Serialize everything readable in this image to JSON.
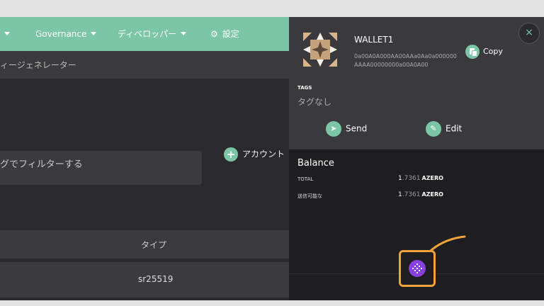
{
  "nav": {
    "governance": "Governance",
    "developer": "ディベロッパー",
    "settings": "設定"
  },
  "subbar": {
    "text": "ィージェネレーター"
  },
  "filter": {
    "placeholder": "グでフィルターする"
  },
  "add_account": {
    "label": "アカウント"
  },
  "table": {
    "header_type": "タイプ",
    "row_type": "sr25519"
  },
  "panel": {
    "wallet_name": "WALLET1",
    "address": "0a00A0A000AA00AAa0Aa0a000000AAAA00000000a00A0A00",
    "copy_label": "Copy",
    "tags_label": "TAGS",
    "tags_value": "タグなし",
    "send_label": "Send",
    "edit_label": "Edit",
    "balance_title": "Balance",
    "total_label": "TOTAL",
    "total_int": "1",
    "total_dec": ".7361",
    "total_unit": "AZERO",
    "transferable_label": "送信可能な",
    "transferable_int": "1",
    "transferable_dec": ".7361",
    "transferable_unit": "AZERO",
    "close_label": "×"
  },
  "colors": {
    "accent": "#7bc6a6",
    "highlight": "#f0a23a",
    "extension": "#8a3fe0"
  }
}
